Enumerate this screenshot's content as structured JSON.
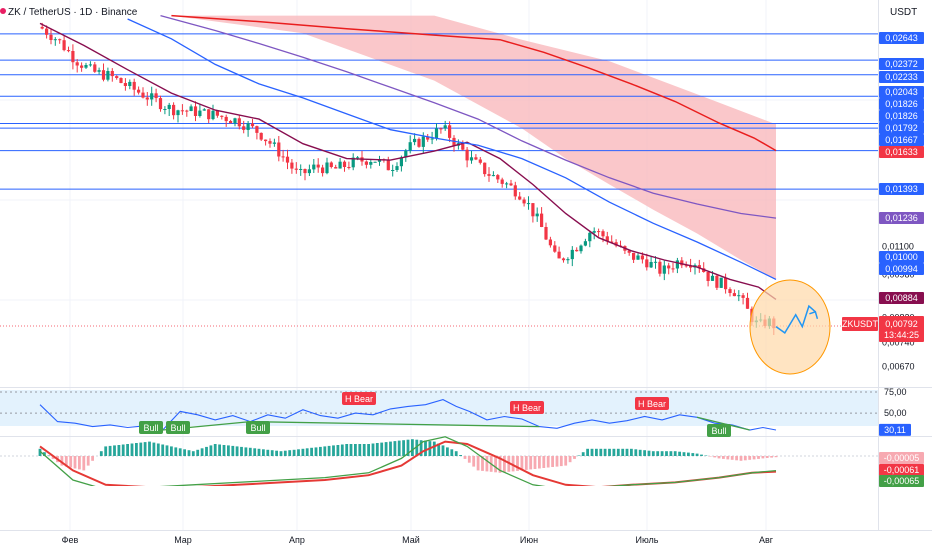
{
  "header": {
    "title": "ZK / TetherUS · 1D · Binance",
    "currency": "USDT"
  },
  "price_axis": {
    "ticks": [
      "0,01100",
      "0,00980",
      "0,00820",
      "0,00740",
      "0,00670"
    ],
    "level_labels": [
      "0,02643",
      "0,02372",
      "0,02233",
      "0,02043",
      "0,01826",
      "0,01826",
      "0,01792",
      "0,01667",
      "0,01633",
      "0,01393",
      "0,01000",
      "0,00994"
    ],
    "ma_labels": [
      {
        "value": "0,01236",
        "color": "#7e57c2"
      },
      {
        "value": "0,00884",
        "color": "#880e4f"
      }
    ],
    "current": {
      "symbol": "ZKUSDT",
      "price": "0,00792",
      "countdown": "13:44:25",
      "color": "#f23645"
    }
  },
  "rsi_axis": {
    "ticks": [
      "75,00",
      "50,00"
    ],
    "current": "30,11"
  },
  "macd_axis": {
    "labels": [
      "-0,00005",
      "-0,00061",
      "-0,00065"
    ]
  },
  "time_axis": {
    "labels": [
      "Фев",
      "Мар",
      "Апр",
      "Май",
      "Июн",
      "Июль",
      "Авг"
    ]
  },
  "rsi_labels": {
    "bull": [
      "Bull",
      "Bull",
      "Bull",
      "Bull"
    ],
    "bear": [
      "H Bear",
      "H Bear",
      "H Bear"
    ]
  },
  "colors": {
    "level_line": "#2962ff",
    "ma_fast": "#880e4f",
    "ma_mid": "#2962ff",
    "ma_slow": "#7e57c2",
    "ma_200": "#e91e1e",
    "band": "#f8b4b8",
    "up": "#089981",
    "down": "#f23645",
    "circle_fill": "#ffd9a8",
    "circle_stroke": "#ff9800",
    "projection": "#2196f3",
    "rsi": "#2962ff",
    "bull": "#43a047",
    "bear": "#f23645"
  },
  "chart_data": {
    "type": "candlestick",
    "title": "ZK / TetherUS · 1D · Binance",
    "ylabel": "USDT",
    "x": [
      "Фев",
      "Мар",
      "Апр",
      "Май",
      "Июн",
      "Июль",
      "Авг"
    ],
    "ylim": [
      0.0062,
      0.0285
    ],
    "horizontal_levels": [
      0.02643,
      0.02372,
      0.02233,
      0.02043,
      0.01826,
      0.01792,
      0.01633,
      0.01393
    ],
    "close_path": [
      [
        0,
        0.0272
      ],
      [
        8,
        0.0258
      ],
      [
        16,
        0.0238
      ],
      [
        24,
        0.0226
      ],
      [
        32,
        0.0222
      ],
      [
        40,
        0.0213
      ],
      [
        50,
        0.0203
      ],
      [
        60,
        0.0194
      ],
      [
        70,
        0.0192
      ],
      [
        80,
        0.0189
      ],
      [
        90,
        0.0185
      ],
      [
        100,
        0.0176
      ],
      [
        110,
        0.0161
      ],
      [
        118,
        0.0147
      ],
      [
        126,
        0.0153
      ],
      [
        134,
        0.0151
      ],
      [
        144,
        0.0156
      ],
      [
        152,
        0.0158
      ],
      [
        160,
        0.0152
      ],
      [
        168,
        0.0165
      ],
      [
        176,
        0.0172
      ],
      [
        184,
        0.0179
      ],
      [
        190,
        0.0168
      ],
      [
        196,
        0.0158
      ],
      [
        204,
        0.0149
      ],
      [
        212,
        0.0143
      ],
      [
        220,
        0.0136
      ],
      [
        228,
        0.0121
      ],
      [
        236,
        0.0103
      ],
      [
        244,
        0.0109
      ],
      [
        252,
        0.0118
      ],
      [
        260,
        0.0113
      ],
      [
        268,
        0.0106
      ],
      [
        276,
        0.0104
      ],
      [
        284,
        0.0099
      ],
      [
        292,
        0.0104
      ],
      [
        300,
        0.0103
      ],
      [
        306,
        0.0096
      ],
      [
        312,
        0.0094
      ],
      [
        318,
        0.0091
      ],
      [
        324,
        0.0083
      ],
      [
        328,
        0.0079
      ],
      [
        332,
        0.0081
      ],
      [
        336,
        0.0079
      ]
    ],
    "series": [
      {
        "name": "",
        "color": "#880e4f",
        "points": [
          [
            0,
            0.0276
          ],
          [
            20,
            0.0252
          ],
          [
            40,
            0.0228
          ],
          [
            60,
            0.0207
          ],
          [
            80,
            0.0193
          ],
          [
            100,
            0.0186
          ],
          [
            120,
            0.0168
          ],
          [
            140,
            0.0158
          ],
          [
            160,
            0.0157
          ],
          [
            180,
            0.0163
          ],
          [
            195,
            0.0169
          ],
          [
            210,
            0.0158
          ],
          [
            225,
            0.0142
          ],
          [
            240,
            0.0126
          ],
          [
            255,
            0.0114
          ],
          [
            270,
            0.0108
          ],
          [
            285,
            0.0104
          ],
          [
            300,
            0.0101
          ],
          [
            315,
            0.0096
          ],
          [
            328,
            0.0093
          ],
          [
            336,
            0.00884
          ]
        ]
      },
      {
        "name": "",
        "color": "#2962ff",
        "points": [
          [
            40,
            0.0281
          ],
          [
            60,
            0.0259
          ],
          [
            80,
            0.0233
          ],
          [
            100,
            0.0215
          ],
          [
            120,
            0.0203
          ],
          [
            140,
            0.019
          ],
          [
            160,
            0.0178
          ],
          [
            180,
            0.0172
          ],
          [
            200,
            0.0167
          ],
          [
            220,
            0.0158
          ],
          [
            240,
            0.0146
          ],
          [
            260,
            0.0132
          ],
          [
            280,
            0.0121
          ],
          [
            300,
            0.0112
          ],
          [
            320,
            0.0103
          ],
          [
            336,
            0.0096
          ]
        ]
      },
      {
        "name": "",
        "color": "#7e57c2",
        "points": [
          [
            55,
            0.0285
          ],
          [
            80,
            0.0268
          ],
          [
            100,
            0.0254
          ],
          [
            120,
            0.024
          ],
          [
            140,
            0.0226
          ],
          [
            160,
            0.0212
          ],
          [
            180,
            0.0199
          ],
          [
            200,
            0.0186
          ],
          [
            220,
            0.017
          ],
          [
            240,
            0.0157
          ],
          [
            260,
            0.0146
          ],
          [
            280,
            0.0137
          ],
          [
            300,
            0.0131
          ],
          [
            320,
            0.0126
          ],
          [
            336,
            0.01236
          ]
        ]
      },
      {
        "name": "",
        "color": "#e91e1e",
        "points": [
          [
            60,
            0.0285
          ],
          [
            100,
            0.0278
          ],
          [
            140,
            0.027
          ],
          [
            180,
            0.0263
          ],
          [
            210,
            0.0258
          ],
          [
            230,
            0.0245
          ],
          [
            250,
            0.023
          ],
          [
            270,
            0.0215
          ],
          [
            290,
            0.02
          ],
          [
            310,
            0.0183
          ],
          [
            326,
            0.0172
          ],
          [
            336,
            0.01633
          ]
        ]
      }
    ],
    "band": {
      "upper": [
        [
          60,
          0.0285
        ],
        [
          120,
          0.0285
        ],
        [
          180,
          0.0285
        ],
        [
          220,
          0.0258
        ],
        [
          260,
          0.0236
        ],
        [
          300,
          0.0206
        ],
        [
          336,
          0.0182
        ]
      ],
      "lower": [
        [
          60,
          0.0285
        ],
        [
          120,
          0.0265
        ],
        [
          180,
          0.0218
        ],
        [
          220,
          0.0179
        ],
        [
          240,
          0.0158
        ],
        [
          260,
          0.0142
        ],
        [
          280,
          0.0128
        ],
        [
          300,
          0.0116
        ],
        [
          320,
          0.0104
        ],
        [
          336,
          0.0096
        ]
      ]
    },
    "projection": [
      [
        336,
        0.0079
      ],
      [
        340,
        0.0077
      ],
      [
        345,
        0.0083
      ],
      [
        348,
        0.0079
      ],
      [
        351,
        0.0086
      ],
      [
        354,
        0.0084
      ]
    ],
    "rsi": {
      "ylim": [
        0,
        100
      ],
      "levels": [
        75,
        50
      ],
      "current": 30.11,
      "points": [
        [
          0,
          60
        ],
        [
          8,
          40
        ],
        [
          16,
          38
        ],
        [
          24,
          34
        ],
        [
          32,
          36
        ],
        [
          40,
          33
        ],
        [
          48,
          35
        ],
        [
          56,
          30
        ],
        [
          64,
          52
        ],
        [
          72,
          48
        ],
        [
          80,
          42
        ],
        [
          88,
          47
        ],
        [
          96,
          40
        ],
        [
          104,
          48
        ],
        [
          112,
          44
        ],
        [
          120,
          54
        ],
        [
          128,
          47
        ],
        [
          136,
          44
        ],
        [
          144,
          50
        ],
        [
          152,
          48
        ],
        [
          160,
          55
        ],
        [
          168,
          58
        ],
        [
          176,
          60
        ],
        [
          184,
          66
        ],
        [
          190,
          58
        ],
        [
          196,
          52
        ],
        [
          204,
          42
        ],
        [
          212,
          46
        ],
        [
          220,
          43
        ],
        [
          228,
          34
        ],
        [
          236,
          32
        ],
        [
          244,
          38
        ],
        [
          252,
          42
        ],
        [
          260,
          38
        ],
        [
          268,
          41
        ],
        [
          276,
          46
        ],
        [
          284,
          42
        ],
        [
          292,
          48
        ],
        [
          300,
          45
        ],
        [
          308,
          38
        ],
        [
          316,
          36
        ],
        [
          324,
          30
        ],
        [
          330,
          33
        ],
        [
          336,
          30
        ]
      ]
    },
    "macd": {
      "ylim": [
        -0.0017,
        0.0012
      ],
      "histogram": [
        [
          0,
          0.0003
        ],
        [
          10,
          -0.0004
        ],
        [
          20,
          -0.0006
        ],
        [
          30,
          0.0004
        ],
        [
          40,
          0.0005
        ],
        [
          50,
          0.0006
        ],
        [
          60,
          0.0004
        ],
        [
          70,
          0.0002
        ],
        [
          80,
          0.0005
        ],
        [
          90,
          0.0004
        ],
        [
          100,
          0.0003
        ],
        [
          110,
          0.0002
        ],
        [
          120,
          0.0003
        ],
        [
          130,
          0.0004
        ],
        [
          140,
          0.0005
        ],
        [
          150,
          0.0005
        ],
        [
          160,
          0.0006
        ],
        [
          170,
          0.0007
        ],
        [
          180,
          0.0006
        ],
        [
          190,
          0.0002
        ],
        [
          200,
          -0.0006
        ],
        [
          210,
          -0.0007
        ],
        [
          220,
          -0.0006
        ],
        [
          230,
          -0.0005
        ],
        [
          240,
          -0.0004
        ],
        [
          250,
          0.0003
        ],
        [
          260,
          0.0003
        ],
        [
          270,
          0.0003
        ],
        [
          280,
          0.0002
        ],
        [
          290,
          0.0002
        ],
        [
          300,
          0.0001
        ],
        [
          310,
          -0.0001
        ],
        [
          320,
          -0.0002
        ],
        [
          330,
          -0.0001
        ],
        [
          336,
          -5e-05
        ]
      ],
      "macd_line": [
        [
          0,
          0.0002
        ],
        [
          15,
          -0.001
        ],
        [
          30,
          -0.0014
        ],
        [
          50,
          -0.0013
        ],
        [
          70,
          -0.0012
        ],
        [
          90,
          -0.0011
        ],
        [
          110,
          -0.001
        ],
        [
          130,
          -0.0009
        ],
        [
          150,
          -0.0007
        ],
        [
          165,
          -0.0001
        ],
        [
          175,
          0.0006
        ],
        [
          185,
          0.0008
        ],
        [
          195,
          0.0004
        ],
        [
          210,
          -0.0006
        ],
        [
          225,
          -0.0012
        ],
        [
          240,
          -0.0014
        ],
        [
          255,
          -0.0013
        ],
        [
          270,
          -0.0012
        ],
        [
          290,
          -0.0011
        ],
        [
          310,
          -0.0009
        ],
        [
          325,
          -0.0007
        ],
        [
          336,
          -0.00061
        ]
      ],
      "signal_line": [
        [
          0,
          0.0004
        ],
        [
          15,
          -0.0006
        ],
        [
          30,
          -0.0012
        ],
        [
          50,
          -0.0013
        ],
        [
          70,
          -0.0013
        ],
        [
          90,
          -0.0012
        ],
        [
          110,
          -0.0011
        ],
        [
          130,
          -0.001
        ],
        [
          150,
          -0.0008
        ],
        [
          165,
          -0.0004
        ],
        [
          175,
          0.0002
        ],
        [
          185,
          0.0006
        ],
        [
          195,
          0.0005
        ],
        [
          210,
          -0.0001
        ],
        [
          225,
          -0.0008
        ],
        [
          240,
          -0.0012
        ],
        [
          255,
          -0.0013
        ],
        [
          270,
          -0.0012
        ],
        [
          290,
          -0.0011
        ],
        [
          310,
          -0.0009
        ],
        [
          325,
          -0.0007
        ],
        [
          336,
          -0.00065
        ]
      ]
    }
  }
}
